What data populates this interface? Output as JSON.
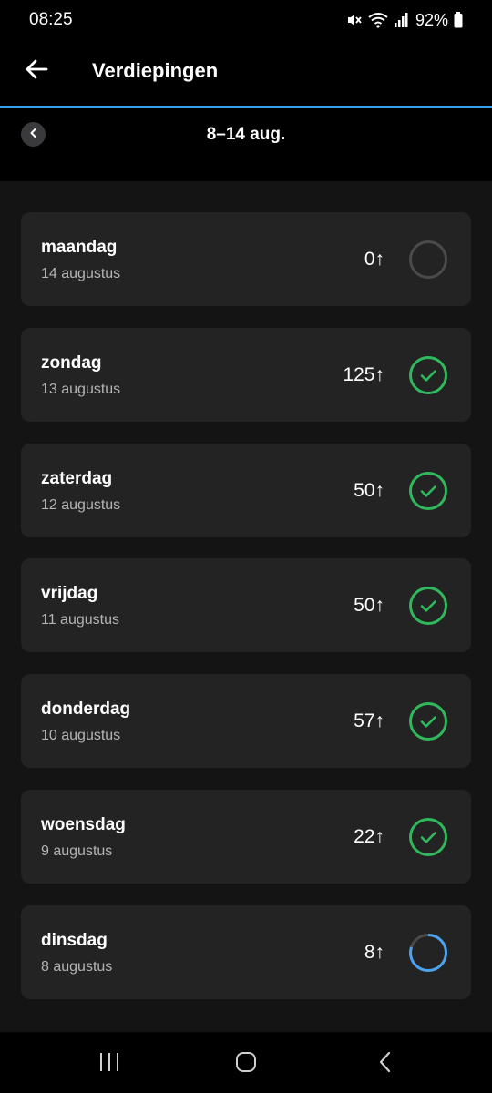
{
  "status_bar": {
    "time": "08:25",
    "battery": "92%",
    "icons": [
      "mute-icon",
      "wifi-icon",
      "signal-icon",
      "battery-icon"
    ]
  },
  "app_bar": {
    "title": "Verdiepingen",
    "back_icon": "arrow-left-icon"
  },
  "week": {
    "label": "8–14 aug.",
    "prev_icon": "chevron-left-icon"
  },
  "days": [
    {
      "name": "maandag",
      "date": "14 augustus",
      "floors": "0↑",
      "status": "empty",
      "progress": 0
    },
    {
      "name": "zondag",
      "date": "13 augustus",
      "floors": "125↑",
      "status": "complete",
      "progress": 1
    },
    {
      "name": "zaterdag",
      "date": "12 augustus",
      "floors": "50↑",
      "status": "complete",
      "progress": 1
    },
    {
      "name": "vrijdag",
      "date": "11 augustus",
      "floors": "50↑",
      "status": "complete",
      "progress": 1
    },
    {
      "name": "donderdag",
      "date": "10 augustus",
      "floors": "57↑",
      "status": "complete",
      "progress": 1
    },
    {
      "name": "woensdag",
      "date": "9 augustus",
      "floors": "22↑",
      "status": "complete",
      "progress": 1
    },
    {
      "name": "dinsdag",
      "date": "8 augustus",
      "floors": "8↑",
      "status": "partial",
      "progress": 0.8
    }
  ],
  "colors": {
    "accent": "#3ba0e6",
    "complete": "#2fb85c",
    "partial": "#4aa3f0",
    "ring_empty": "#4a4a4a"
  },
  "nav_bar": {
    "icons": [
      "recents-icon",
      "home-icon",
      "back-nav-icon"
    ]
  }
}
